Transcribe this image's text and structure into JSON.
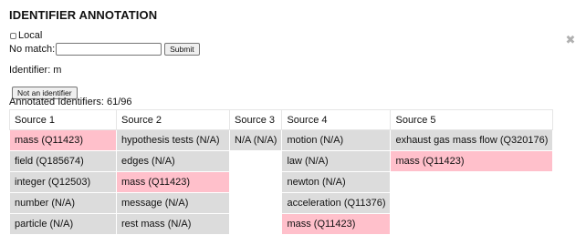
{
  "page": {
    "title": "IDENTIFIER ANNOTATION",
    "local_label": "Local",
    "no_match_label": "No match:",
    "no_match_value": "",
    "submit_label": "Submit",
    "identifier_text": "Identifier: m",
    "not_identifier_label": "Not an identifier",
    "annotated_count_text": "Annotated Identifiers: 61/96",
    "close_glyph": "✖"
  },
  "colors": {
    "candidate": "#dcdcdc",
    "selected": "#ffc0cb",
    "empty": "#ffffff"
  },
  "table": {
    "headers": [
      "Source 1",
      "Source 2",
      "Source 3",
      "Source 4",
      "Source 5"
    ],
    "rows": [
      [
        {
          "text": "mass (Q11423)",
          "state": "selected"
        },
        {
          "text": "hypothesis tests (N/A)",
          "state": "candidate"
        },
        {
          "text": "N/A (N/A)",
          "state": "candidate"
        },
        {
          "text": "motion (N/A)",
          "state": "candidate"
        },
        {
          "text": "exhaust gas mass flow (Q320176)",
          "state": "candidate"
        }
      ],
      [
        {
          "text": "field (Q185674)",
          "state": "candidate"
        },
        {
          "text": "edges (N/A)",
          "state": "candidate"
        },
        {
          "text": "",
          "state": "empty"
        },
        {
          "text": "law (N/A)",
          "state": "candidate"
        },
        {
          "text": "mass (Q11423)",
          "state": "selected"
        }
      ],
      [
        {
          "text": "integer (Q12503)",
          "state": "candidate"
        },
        {
          "text": "mass (Q11423)",
          "state": "selected"
        },
        {
          "text": "",
          "state": "empty"
        },
        {
          "text": "newton (N/A)",
          "state": "candidate"
        },
        {
          "text": "",
          "state": "empty"
        }
      ],
      [
        {
          "text": "number (N/A)",
          "state": "candidate"
        },
        {
          "text": "message (N/A)",
          "state": "candidate"
        },
        {
          "text": "",
          "state": "empty"
        },
        {
          "text": "acceleration (Q11376)",
          "state": "candidate"
        },
        {
          "text": "",
          "state": "empty"
        }
      ],
      [
        {
          "text": "particle (N/A)",
          "state": "candidate"
        },
        {
          "text": "rest mass (N/A)",
          "state": "candidate"
        },
        {
          "text": "",
          "state": "empty"
        },
        {
          "text": "mass (Q11423)",
          "state": "selected"
        },
        {
          "text": "",
          "state": "empty"
        }
      ]
    ]
  }
}
